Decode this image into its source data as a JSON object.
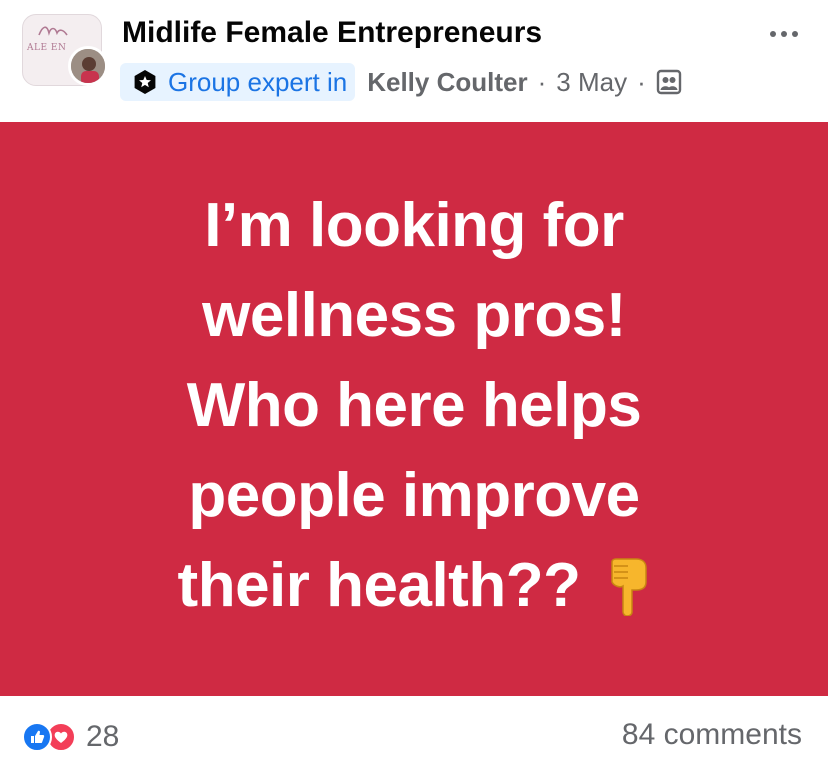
{
  "post": {
    "group_name": "Midlife Female Entrepreneurs",
    "group_logo_text": "ALE EN",
    "badge_label": "Group expert in",
    "author": "Kelly Coulter",
    "separator": "·",
    "date": "3 May",
    "text_lines": [
      "I’m looking for",
      "wellness pros!",
      "Who here helps",
      "people improve",
      "their health??"
    ],
    "background_color": "#cf2a43",
    "emoji_icon": "backhand-pointing-down-icon"
  },
  "footer": {
    "reaction_count": "28",
    "comments_label": "84 comments"
  },
  "icons": {
    "more": "more-dots-icon",
    "badge": "group-expert-icon",
    "audience": "members-icon",
    "like": "like-reaction-icon",
    "love": "love-reaction-icon"
  },
  "colors": {
    "accent": "#1b74e4",
    "badge_bg": "#e7f3ff",
    "secondary_text": "#65676b",
    "like": "#1877f2",
    "love": "#f33e58"
  }
}
